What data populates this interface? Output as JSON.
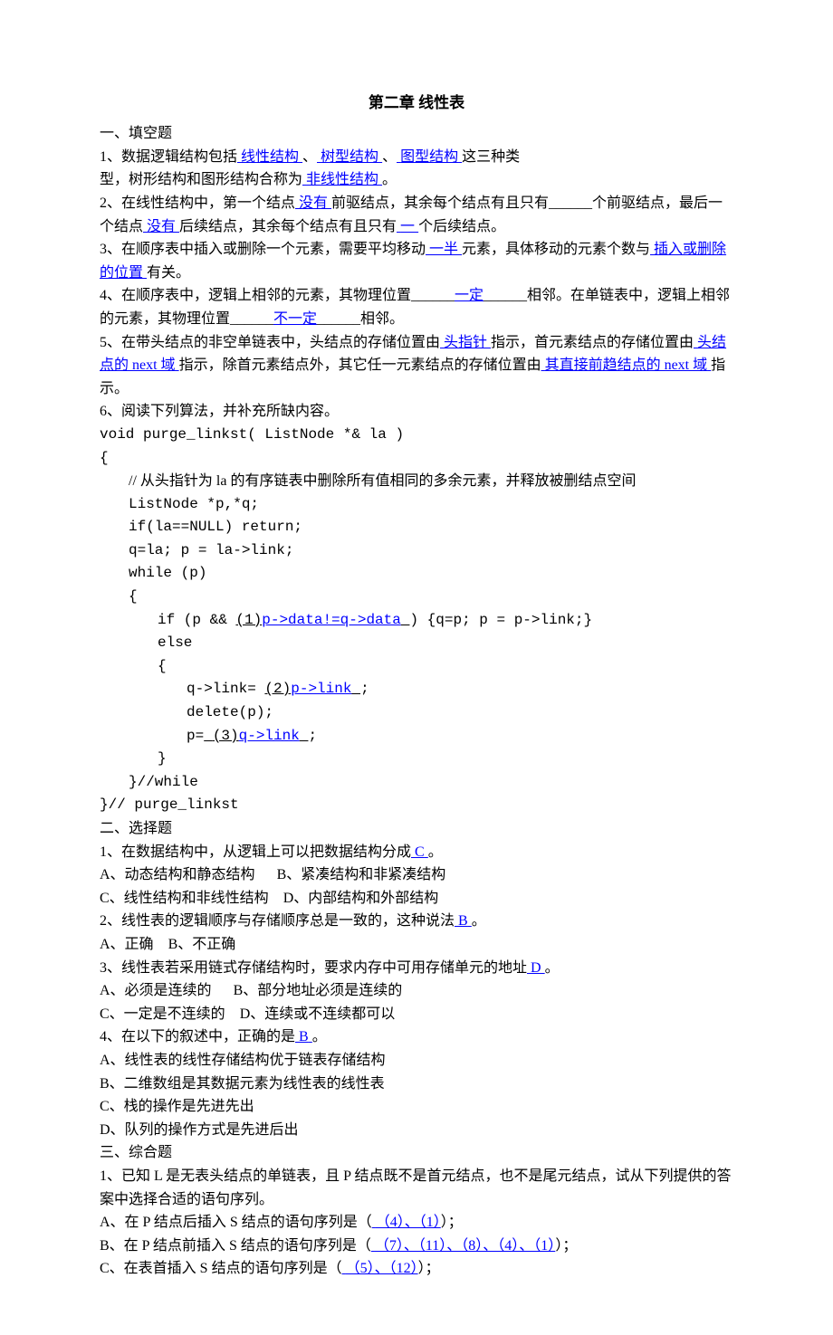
{
  "title": "第二章 线性表",
  "s1": {
    "heading": "一、填空题",
    "q1": {
      "t1": "1、数据逻辑结构包括",
      "a1": "线性结构",
      "t2": "、",
      "a2": "树型结构",
      "t3": "、",
      "a3": "图型结构",
      "t4": "这三种类型，树形结构和图形结构合称为",
      "a4": "非线性结构",
      "t5": "。"
    },
    "q2": {
      "t1": "2、在线性结构中，第一个结点",
      "a1": "没有",
      "t2": "前驱结点，其余每个结点有且只有______个前驱结点，最后一个结点",
      "a2": "没有",
      "t3": "后续结点，其余每个结点有且只有",
      "a3": "一",
      "t4": "个后续结点。"
    },
    "q3": {
      "t1": "3、在顺序表中插入或删除一个元素，需要平均移动",
      "a1": "一半",
      "t2": "元素，具体移动的元素个数与",
      "a2": "插入或删除的位置",
      "t3": "有关。"
    },
    "q4": {
      "t1": "4、在顺序表中，逻辑上相邻的元素，其物理位置______",
      "a1": "一定",
      "t2": "______相邻。在单链表中，逻辑上相邻的元素，其物理位置______",
      "a2": "不一定",
      "t3": "______相邻。"
    },
    "q5": {
      "t1": "5、在带头结点的非空单链表中，头结点的存储位置由",
      "a1": "头指针",
      "t2": "指示，首元素结点的存储位置由",
      "a2": "头结点的 next 域",
      "t3": "指示，除首元素结点外，其它任一元素结点的存储位置由",
      "a3": "其直接前趋结点的 next 域",
      "t4": "指示。"
    },
    "q6": {
      "head": "6、阅读下列算法，并补充所缺内容。",
      "l1": "void purge_linkst( ListNode *& la )",
      "l2": "{",
      "l3": "// 从头指针为 la 的有序链表中删除所有值相同的多余元素，并释放被删结点空间",
      "l4": "ListNode *p,*q;",
      "l5": "if(la==NULL) return;",
      "l6": "q=la; p = la->link;",
      "l7": "while (p)",
      "l8": "{",
      "l9a": "if (p && ",
      "l9b": "(1)",
      "l9c": "p->data!=q->data",
      "l9d": " )  {q=p; p = p->link;}",
      "l10": "else",
      "l11": "{",
      "l12a": "q->link= ",
      "l12b": "(2)",
      "l12c": "p->link",
      "l12d": ";",
      "l13": "delete(p);",
      "l14a": "p=",
      "l14b": "(3)",
      "l14c": "q->link",
      "l14d": ";",
      "l15": "}",
      "l16": "}//while",
      "l17": "}// purge_linkst"
    }
  },
  "s2": {
    "heading": "二、选择题",
    "q1": {
      "t": "1、在数据结构中，从逻辑上可以把数据结构分成",
      "a": "C",
      "tail": "。"
    },
    "q1opts": {
      "a": "A、动态结构和静态结构",
      "b": "B、紧凑结构和非紧凑结构",
      "c": "C、线性结构和非线性结构",
      "d": "D、内部结构和外部结构"
    },
    "q2": {
      "t": "2、线性表的逻辑顺序与存储顺序总是一致的，这种说法",
      "a": "B",
      "tail": "。"
    },
    "q2opts": {
      "a": "A、正确",
      "b": "B、不正确"
    },
    "q3": {
      "t": "3、线性表若采用链式存储结构时，要求内存中可用存储单元的地址",
      "a": "D",
      "tail": "。"
    },
    "q3opts": {
      "a": "A、必须是连续的",
      "b": "B、部分地址必须是连续的",
      "c": "C、一定是不连续的",
      "d": "D、连续或不连续都可以"
    },
    "q4": {
      "t": "4、在以下的叙述中，正确的是",
      "a": "B",
      "tail": "。"
    },
    "q4opts": {
      "a": "A、线性表的线性存储结构优于链表存储结构",
      "b": "B、二维数组是其数据元素为线性表的线性表",
      "c": "C、栈的操作是先进先出",
      "d": "D、队列的操作方式是先进后出"
    }
  },
  "s3": {
    "heading": "三、综合题",
    "q1": "1、已知 L 是无表头结点的单链表，且 P 结点既不是首元结点，也不是尾元结点，试从下列提供的答案中选择合适的语句序列。",
    "a": {
      "t": "A、在 P 结点后插入 S 结点的语句序列是（",
      "ans": "（4）、（1）",
      "tail": "）；"
    },
    "b": {
      "t": "B、在 P 结点前插入 S 结点的语句序列是（",
      "ans": "（7）、（11）、（8）、（4）、（1）",
      "tail": "）；"
    },
    "c": {
      "t": "C、在表首插入 S 结点的语句序列是（",
      "ans": "（5）、（12）",
      "tail": "）；"
    }
  }
}
